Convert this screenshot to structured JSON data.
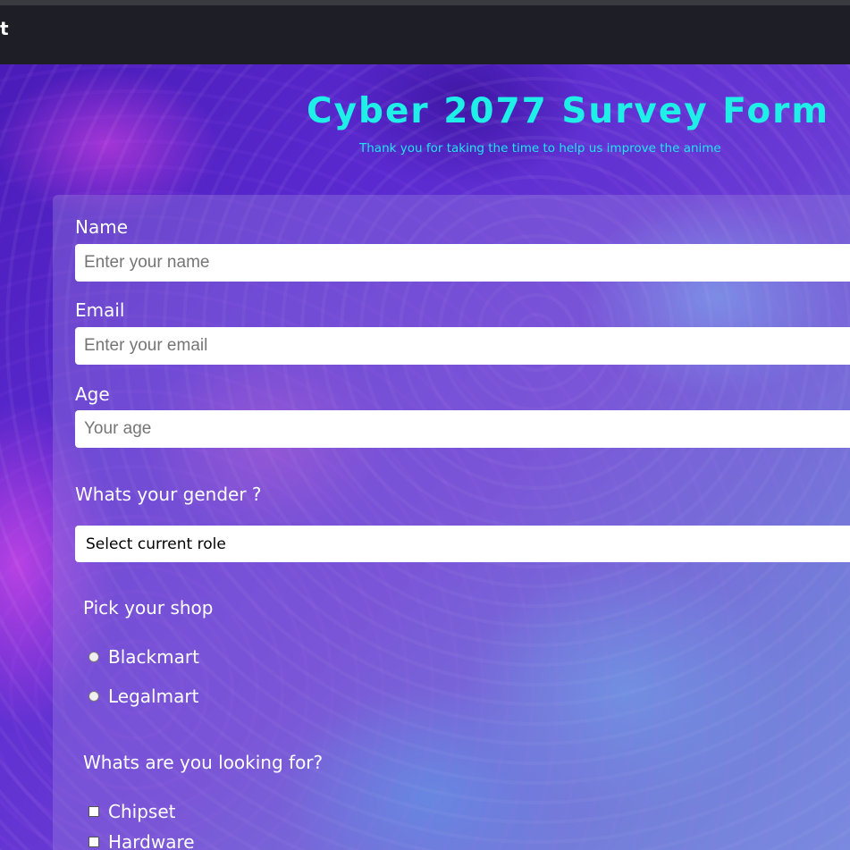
{
  "browser": {
    "title_fragment": "t"
  },
  "header": {
    "title": "Cyber 2077 Survey Form",
    "subtitle": "Thank you for taking the time to help us improve the anime"
  },
  "form": {
    "name": {
      "label": "Name",
      "placeholder": "Enter your name"
    },
    "email": {
      "label": "Email",
      "placeholder": "Enter your email"
    },
    "age": {
      "label": "Age",
      "placeholder": "Your age"
    },
    "gender": {
      "label": "Whats your gender ?",
      "selected": "Select current role"
    },
    "shop": {
      "label": "Pick your shop",
      "options": [
        {
          "label": "Blackmart"
        },
        {
          "label": "Legalmart"
        }
      ]
    },
    "looking_for": {
      "label": "Whats are you looking for?",
      "options": [
        {
          "label": "Chipset"
        },
        {
          "label": "Hardware"
        }
      ]
    }
  },
  "colors": {
    "title": "#1ef0e8",
    "topbar": "#1e1f26",
    "card": "rgba(150,130,220,0.38)"
  }
}
